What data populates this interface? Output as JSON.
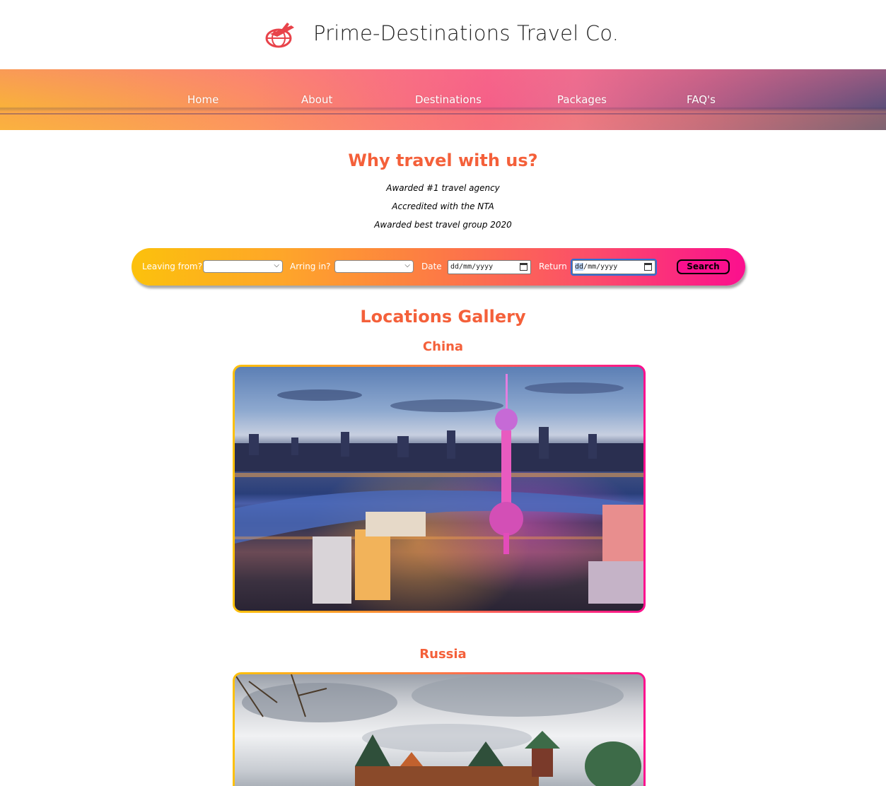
{
  "brand": {
    "name": "Prime-Destinations Travel Co.",
    "logo_icon": "airplane-globe-icon",
    "logo_color": "#e8434a"
  },
  "nav": {
    "items": [
      {
        "label": "Home"
      },
      {
        "label": "About"
      },
      {
        "label": "Destinations"
      },
      {
        "label": "Packages"
      },
      {
        "label": "FAQ's"
      }
    ]
  },
  "why": {
    "title": "Why travel with us?",
    "lines": [
      "Awarded #1 travel agency",
      "Accredited with the NTA",
      "Awarded best travel group 2020"
    ]
  },
  "search": {
    "leaving_label": "Leaving from?",
    "leaving_value": "",
    "arriving_label": "Arring in?",
    "arriving_value": "",
    "date_label": "Date",
    "date_placeholder": "dd/mm/yyyy",
    "return_label": "Return",
    "return_placeholder_day": "dd",
    "return_placeholder_rest": "/mm/yyyy",
    "button_label": "Search"
  },
  "gallery": {
    "title": "Locations Gallery",
    "locations": [
      {
        "name": "China",
        "image": "shanghai-skyline-night-photo"
      },
      {
        "name": "Russia",
        "image": "kolomenskoye-wooden-palace-photo"
      }
    ]
  },
  "colors": {
    "accent": "#f4603a",
    "gradient_start": "#fcc10c",
    "gradient_end": "#fb0f8e"
  }
}
